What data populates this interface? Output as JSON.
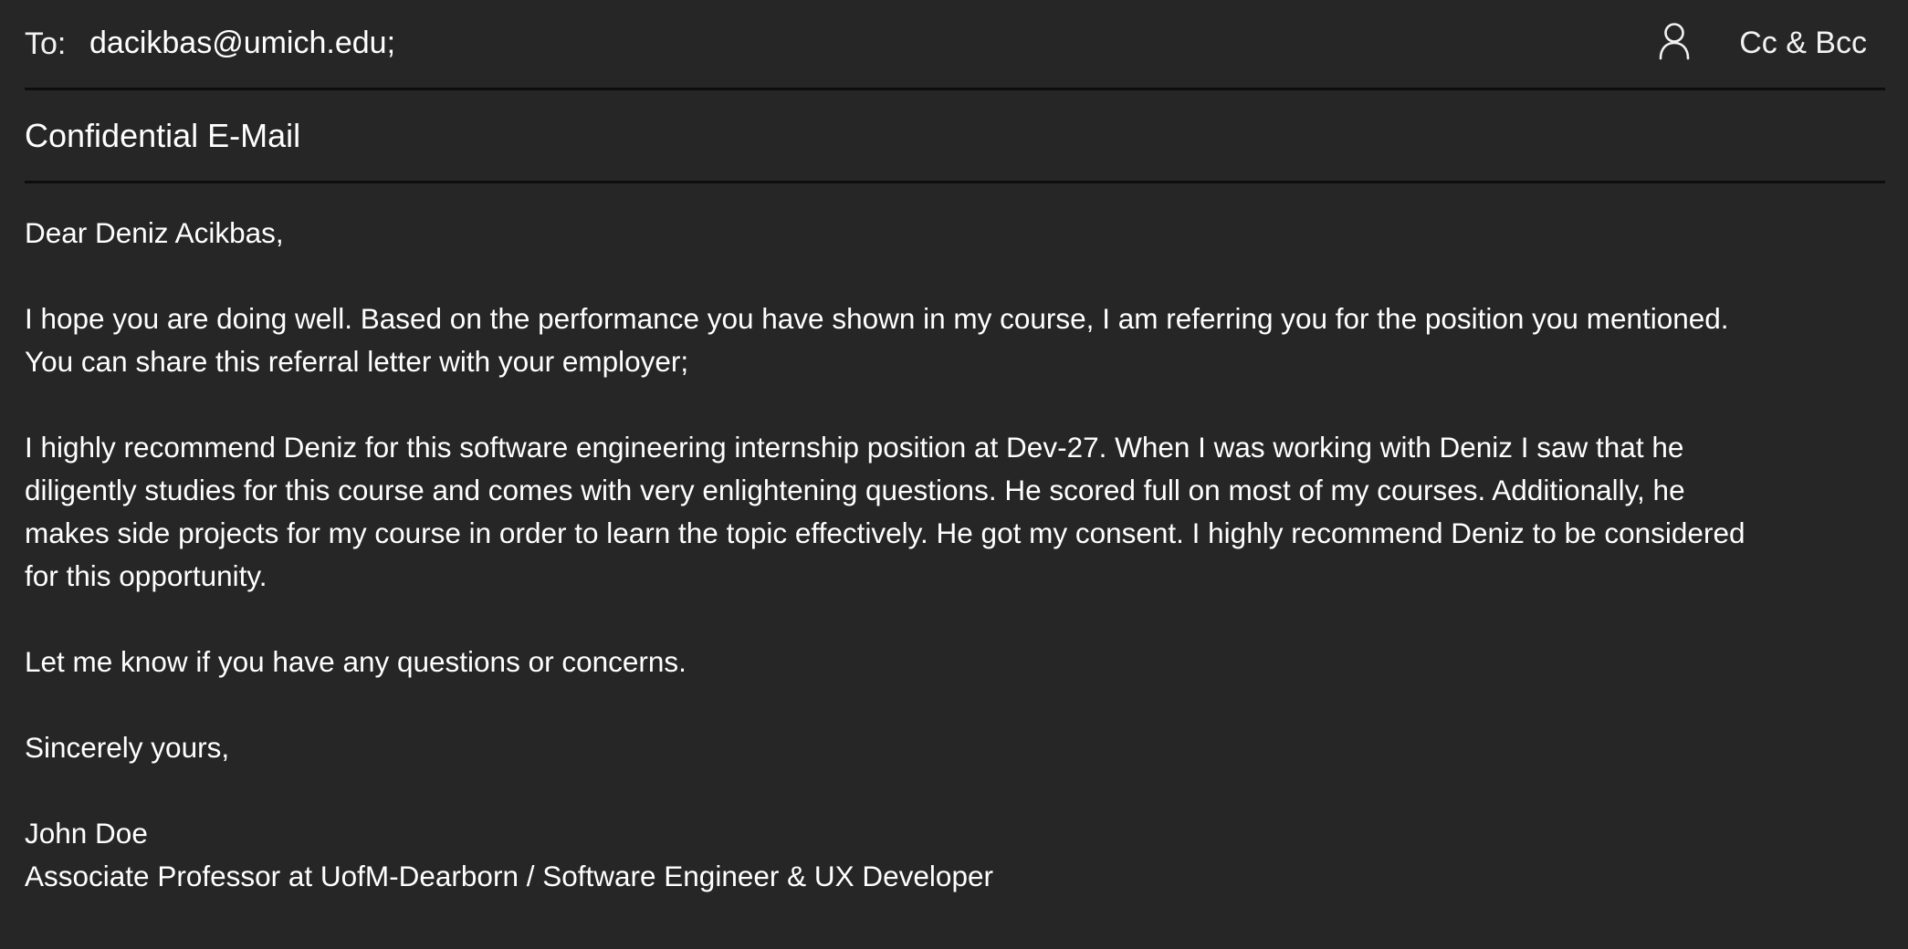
{
  "header": {
    "to_label": "To:",
    "to_value": "dacikbas@umich.edu;",
    "contacts_icon": "person-icon",
    "cc_bcc_label": "Cc & Bcc"
  },
  "subject": "Confidential E-Mail",
  "body": {
    "greeting": "Dear Deniz Acikbas,",
    "paragraph1_line1": "I hope you are doing well. Based on the performance you have shown in my course, I am referring you for the position you mentioned.",
    "paragraph1_line2": "You can share this referral letter with your employer;",
    "paragraph2_line1": "I highly recommend Deniz for this software engineering internship position at Dev-27. When I was working with Deniz I saw that he",
    "paragraph2_line2": "diligently studies for this course and comes with very enlightening questions. He scored full on most of my courses. Additionally, he",
    "paragraph2_line3": "makes side projects for my course in order to learn the topic effectively. He got my consent. I highly recommend Deniz to be considered",
    "paragraph2_line4": "for this opportunity.",
    "paragraph3": "Let me know if you have any questions or concerns.",
    "closing": "Sincerely yours,",
    "signature_name": "John Doe",
    "signature_title": "Associate Professor at UofM-Dearborn / Software Engineer & UX Developer"
  },
  "colors": {
    "background": "#262626",
    "text": "#ffffff",
    "divider": "#0d0d0d"
  }
}
